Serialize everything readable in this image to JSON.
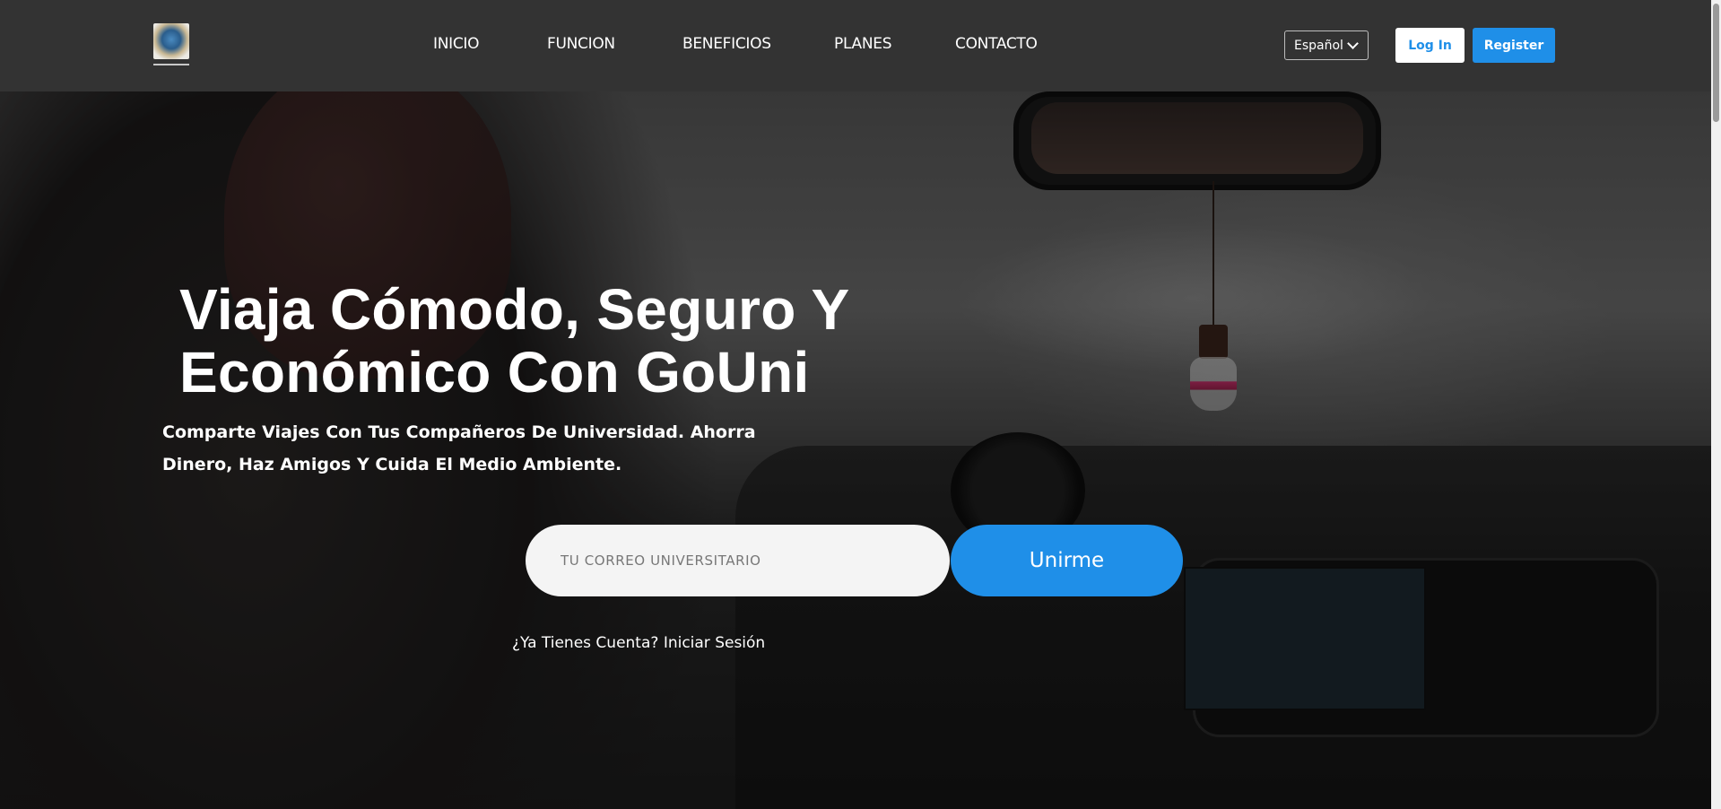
{
  "nav": {
    "logo_icon": "gouni-globe-logo-icon",
    "links": [
      "INICIO",
      "FUNCION",
      "BENEFICIOS",
      "PLANES",
      "CONTACTO"
    ],
    "language": "Español",
    "login_label": "Log In",
    "register_label": "Register"
  },
  "hero": {
    "title_line1": "Viaja Cómodo, Seguro Y",
    "title_line2": "Económico Con GoUni",
    "subtitle_line1": "Comparte Viajes Con Tus Compañeros De Universidad. Ahorra",
    "subtitle_line2": "Dinero, Haz Amigos Y Cuida El Medio Ambiente.",
    "email_placeholder": "TU CORREO UNIVERSITARIO",
    "join_label": "Unirme",
    "login_link": "¿Ya Tienes Cuenta? Iniciar Sesión"
  },
  "colors": {
    "nav_bg": "#333333",
    "accent": "#1f8fe8",
    "text": "#ffffff"
  }
}
